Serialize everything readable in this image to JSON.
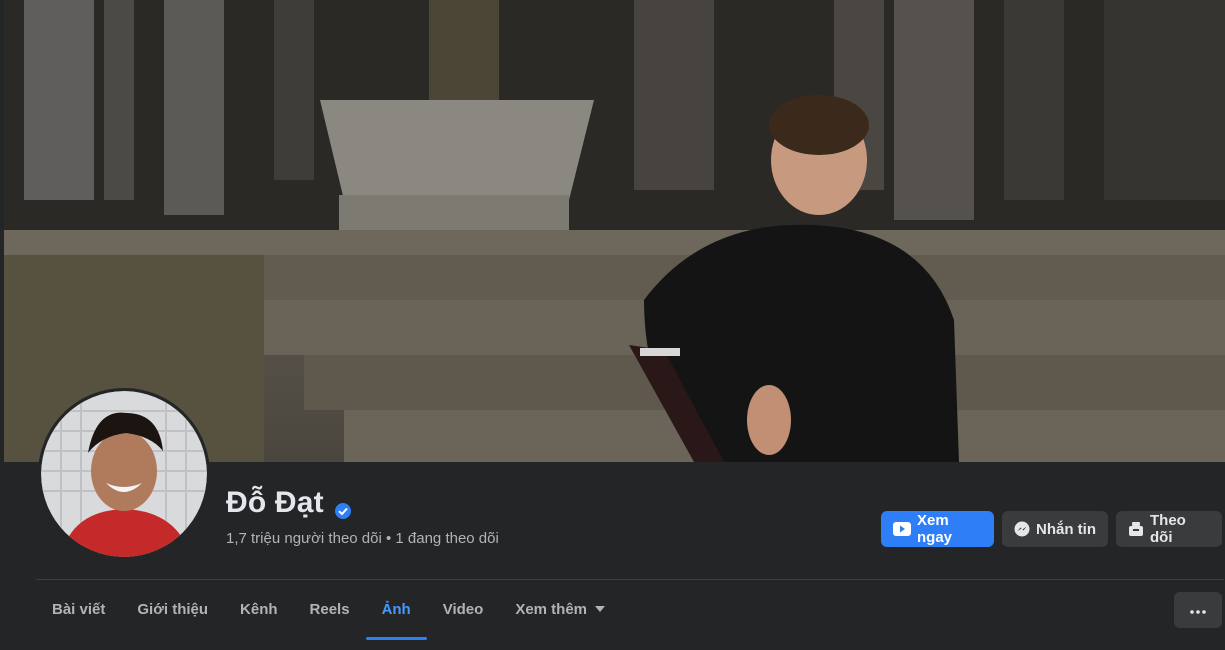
{
  "profile": {
    "name": "Đỗ Đạt",
    "verified": true,
    "stats": "1,7 triệu người theo dõi • 1 đang theo dõi"
  },
  "actions": {
    "watch_now": "Xem ngay",
    "message": "Nhắn tin",
    "follow": "Theo dõi"
  },
  "tabs": [
    {
      "label": "Bài viết",
      "active": false
    },
    {
      "label": "Giới thiệu",
      "active": false
    },
    {
      "label": "Kênh",
      "active": false
    },
    {
      "label": "Reels",
      "active": false
    },
    {
      "label": "Ảnh",
      "active": true
    },
    {
      "label": "Video",
      "active": false
    },
    {
      "label": "Xem thêm",
      "active": false
    }
  ],
  "icons": {
    "verified": "verified-badge-icon",
    "watch": "play-icon",
    "message": "messenger-icon",
    "follow": "follow-icon",
    "more": "more-icon",
    "caret": "caret-down-icon"
  },
  "colors": {
    "accent": "#2d7ef7",
    "background": "#242526",
    "button": "#3a3b3c",
    "active_tab": "#4599ff"
  }
}
